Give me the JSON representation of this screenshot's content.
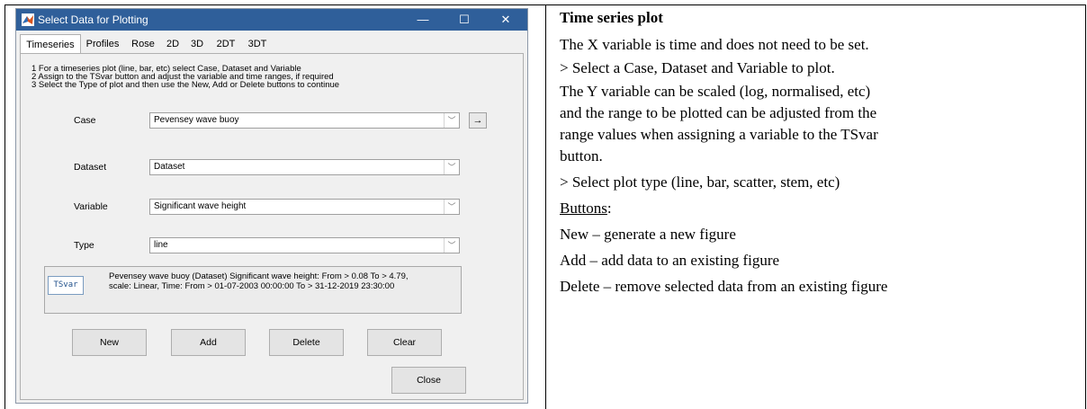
{
  "window": {
    "title": "Select Data for Plotting",
    "controls": {
      "minimize": "—",
      "maximize": "☐",
      "close": "✕"
    }
  },
  "tabs": [
    "Timeseries",
    "Profiles",
    "Rose",
    "2D",
    "3D",
    "2DT",
    "3DT"
  ],
  "instructions": [
    "1 For a timeseries plot (line, bar, etc) select Case, Dataset and Variable",
    "2 Assign to the TSvar button and adjust the variable and time ranges, if required",
    "3 Select the Type of plot and then use the New, Add or Delete buttons to continue"
  ],
  "fields": {
    "case": {
      "label": "Case",
      "value": "Pevensey wave buoy",
      "arrow": "→"
    },
    "dataset": {
      "label": "Dataset",
      "value": "Dataset"
    },
    "variable": {
      "label": "Variable",
      "value": "Significant wave height"
    },
    "type": {
      "label": "Type",
      "value": "line"
    }
  },
  "tsvar": {
    "button": "TSvar",
    "line1": "Pevensey wave buoy (Dataset) Significant wave height: From > 0.08 To > 4.79,",
    "line2": "scale: Linear, Time: From > 01-07-2003 00:00:00 To > 31-12-2019 23:30:00"
  },
  "buttons": {
    "new": "New",
    "add": "Add",
    "delete": "Delete",
    "clear": "Clear",
    "close": "Close"
  },
  "description": {
    "heading": "Time series plot",
    "lines": [
      "The X variable is time and does not need to be set.",
      "> Select a Case, Dataset and Variable to plot.",
      "The Y variable can be scaled (log, normalised, etc)",
      "and the range to be plotted can be adjusted from the",
      "range values when assigning a variable to the TSvar",
      "button.",
      "> Select plot type (line, bar, scatter, stem, etc)"
    ],
    "buttons_heading": "Buttons",
    "buttons_colon": ":",
    "button_lines": [
      "New – generate a new figure",
      "Add – add data to an existing figure",
      "Delete – remove selected data from an existing figure"
    ]
  },
  "colors": {
    "titlebar": "#2f5f9a",
    "tsvar_text": "#1f4f8a"
  }
}
